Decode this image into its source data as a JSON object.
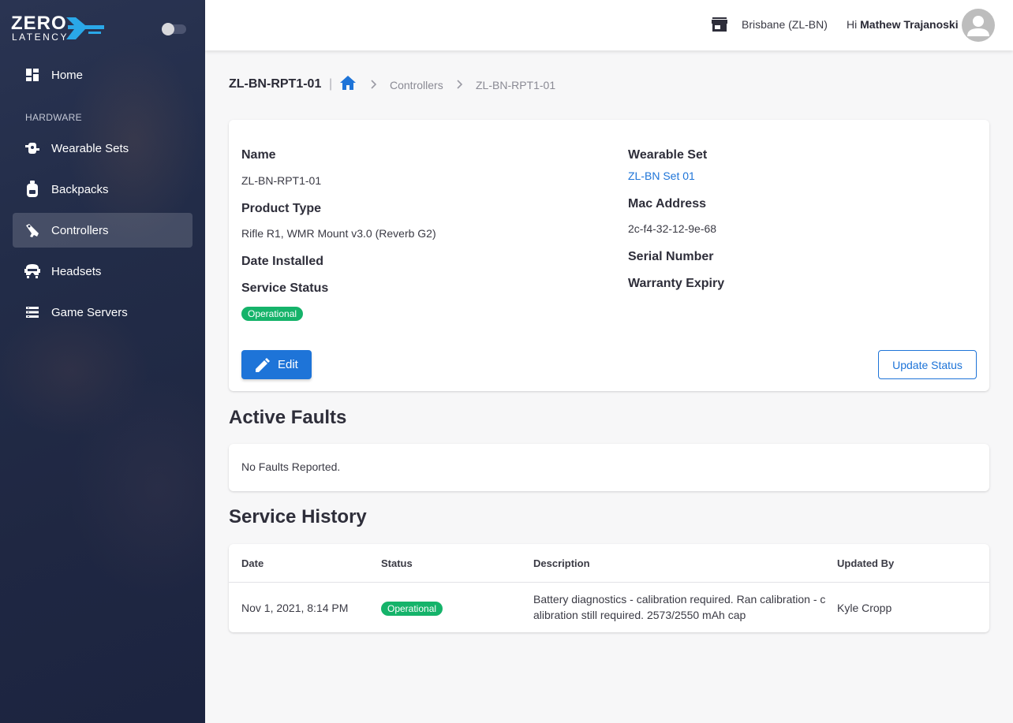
{
  "brand": {
    "logo_word1": "ZERO",
    "logo_word2": "LATENCY",
    "accent": "#1e74d8"
  },
  "sidebar": {
    "items": [
      {
        "label": "Home",
        "icon": "dashboard-icon"
      },
      {
        "label": "Wearable Sets",
        "icon": "wearable-set-icon"
      },
      {
        "label": "Backpacks",
        "icon": "backpack-icon"
      },
      {
        "label": "Controllers",
        "icon": "rifle-controller-icon",
        "active": true
      },
      {
        "label": "Headsets",
        "icon": "headset-icon"
      },
      {
        "label": "Game Servers",
        "icon": "server-icon"
      }
    ],
    "section_hardware": "HARDWARE"
  },
  "topbar": {
    "location": "Brisbane (ZL-BN)",
    "greeting_prefix": "Hi",
    "user_name": "Mathew Trajanoski"
  },
  "breadcrumb": {
    "title": "ZL-BN-RPT1-01",
    "separator": "|",
    "items": [
      "Controllers",
      "ZL-BN-RPT1-01"
    ]
  },
  "details": {
    "name_label": "Name",
    "name_value": "ZL-BN-RPT1-01",
    "product_type_label": "Product Type",
    "product_type_value": "Rifle R1, WMR Mount v3.0 (Reverb G2)",
    "date_installed_label": "Date Installed",
    "service_status_label": "Service Status",
    "service_status_value": "Operational",
    "wearable_set_label": "Wearable Set",
    "wearable_set_value": "ZL-BN Set 01",
    "mac_label": "Mac Address",
    "mac_value": "2c-f4-32-12-9e-68",
    "serial_label": "Serial Number",
    "warranty_label": "Warranty Expiry",
    "edit_label": "Edit",
    "update_status_label": "Update Status"
  },
  "faults": {
    "heading": "Active Faults",
    "empty_text": "No Faults Reported."
  },
  "history": {
    "heading": "Service History",
    "columns": [
      "Date",
      "Status",
      "Description",
      "Updated By"
    ],
    "rows": [
      {
        "date": "Nov 1, 2021, 8:14 PM",
        "status": "Operational",
        "description_line1": "Battery diagnostics - calibration required. Ran calibration - c",
        "description_line2": "alibration still required. 2573/2550 mAh cap",
        "updated_by": "Kyle Cropp"
      }
    ]
  },
  "colors": {
    "operational": "#15b36a",
    "sidebar_bg": "#222c48"
  }
}
